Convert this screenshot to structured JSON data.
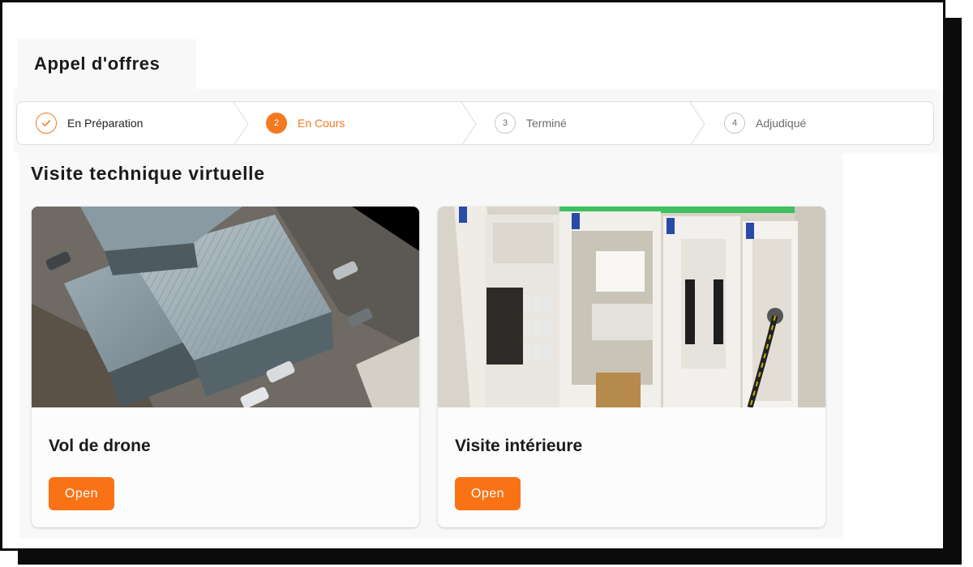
{
  "page": {
    "title": "Appel d'offres"
  },
  "steps": [
    {
      "number": "1",
      "label": "En Préparation",
      "state": "done"
    },
    {
      "number": "2",
      "label": "En Cours",
      "state": "active"
    },
    {
      "number": "3",
      "label": "Terminé",
      "state": "todo"
    },
    {
      "number": "4",
      "label": "Adjudiqué",
      "state": "todo"
    }
  ],
  "section": {
    "title": "Visite technique virtuelle"
  },
  "cards": [
    {
      "title": "Vol de drone",
      "button_label": "Open",
      "image": "aerial-drone-photo"
    },
    {
      "title": "Visite intérieure",
      "button_label": "Open",
      "image": "electrical-cabinet-photo"
    }
  ],
  "colors": {
    "accent": "#f97316",
    "step_accent": "#f37a1f",
    "panel_bg": "#f8f8f8",
    "border": "#dcdcdc"
  }
}
